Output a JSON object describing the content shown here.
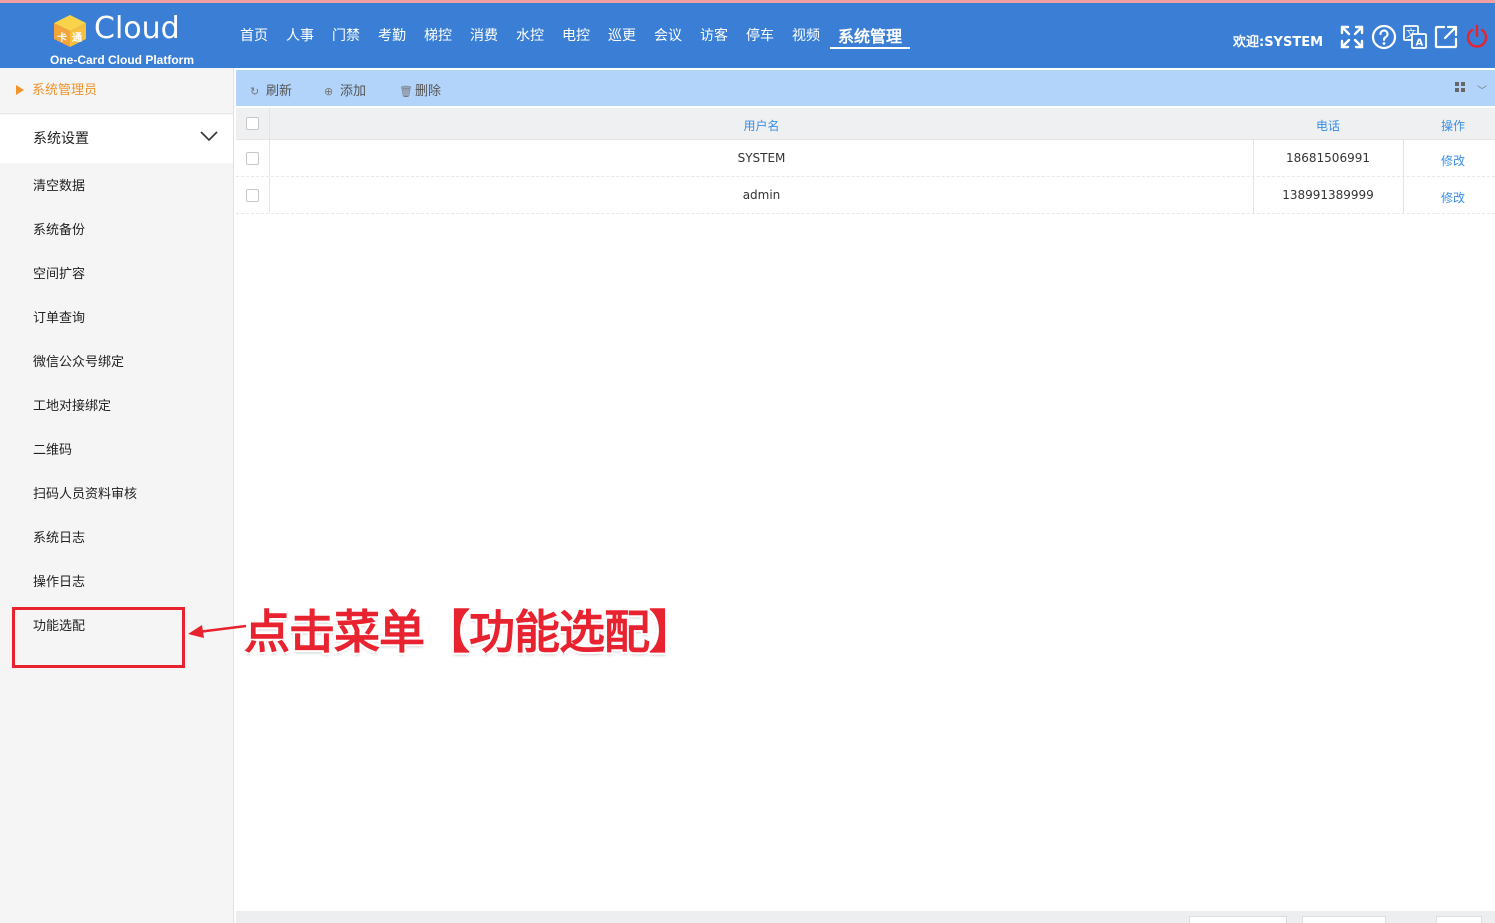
{
  "header": {
    "logo_text": "Cloud",
    "logo_sub": "One-Card Cloud Platform",
    "nav": [
      "首页",
      "人事",
      "门禁",
      "考勤",
      "梯控",
      "消费",
      "水控",
      "电控",
      "巡更",
      "会议",
      "访客",
      "停车",
      "视频",
      "系统管理"
    ],
    "active_nav": "系统管理",
    "welcome": "欢迎:SYSTEM",
    "icons": [
      "fullscreen-icon",
      "help-icon",
      "translate-icon",
      "external-link-icon",
      "power-icon"
    ],
    "colors": {
      "bar": "#3a7fd5",
      "power": "#e8222e"
    }
  },
  "sidebar": {
    "user": "系统管理员",
    "group": "系统设置",
    "items": [
      "清空数据",
      "系统备份",
      "空间扩容",
      "订单查询",
      "微信公众号绑定",
      "工地对接绑定",
      "二维码",
      "扫码人员资料审核",
      "系统日志",
      "操作日志",
      "功能选配"
    ]
  },
  "toolbar": {
    "refresh": "刷新",
    "add": "添加",
    "delete": "删除"
  },
  "table": {
    "columns": [
      "用户名",
      "电话",
      "操作"
    ],
    "rows": [
      {
        "username": "SYSTEM",
        "phone": "18681506991",
        "action": "修改"
      },
      {
        "username": "admin",
        "phone": "138991389999",
        "action": "修改"
      }
    ]
  },
  "annotation": {
    "text": "点击菜单【功能选配】",
    "color": "#e8222e"
  }
}
